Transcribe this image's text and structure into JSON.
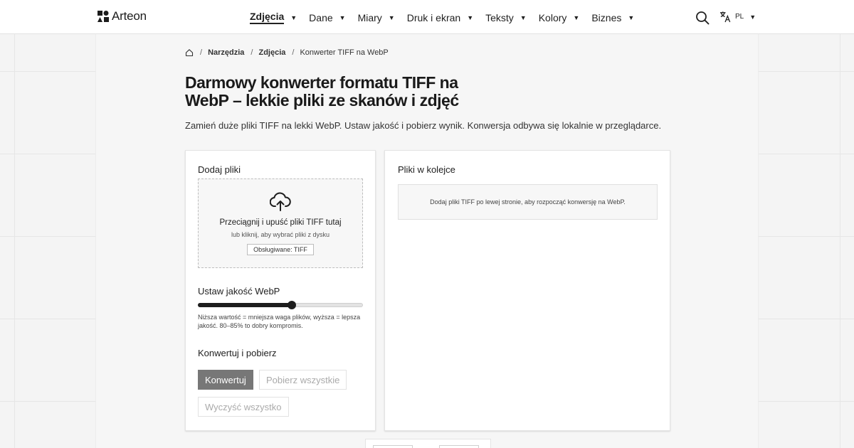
{
  "brand": {
    "name": "Arteon"
  },
  "nav": {
    "items": [
      {
        "label": "Zdjęcia",
        "active": true
      },
      {
        "label": "Dane",
        "active": false
      },
      {
        "label": "Miary",
        "active": false
      },
      {
        "label": "Druk i ekran",
        "active": false
      },
      {
        "label": "Teksty",
        "active": false
      },
      {
        "label": "Kolory",
        "active": false
      },
      {
        "label": "Biznes",
        "active": false
      }
    ],
    "language": "PL",
    "search_icon": "search-icon",
    "language_icon": "translate-icon"
  },
  "breadcrumb": {
    "home_icon": "home-icon",
    "items": [
      "Narzędzia",
      "Zdjęcia"
    ],
    "current": "Konwerter TIFF na WebP"
  },
  "page": {
    "title": "Darmowy konwerter formatu TIFF na WebP – lekkie pliki ze skanów i zdjęć",
    "intro": "Zamień duże pliki TIFF na lekki WebP. Ustaw jakość i pobierz wynik. Konwersja odbywa się lokalnie w przeglądarce."
  },
  "upload": {
    "heading": "Dodaj pliki",
    "icon": "cloud-upload-icon",
    "drop_text": "Przeciągnij i upuść pliki TIFF tutaj",
    "click_text": "lub kliknij, aby wybrać pliki z dysku",
    "supported": "Obsługiwane: TIFF"
  },
  "quality": {
    "heading": "Ustaw jakość WebP",
    "level": 0.57,
    "hint": "Niższa wartość = mniejsza waga plików, wyższa = lepsza jakość. 80–85% to dobry kompromis."
  },
  "actions": {
    "heading": "Konwertuj i pobierz",
    "convert": "Konwertuj",
    "download_all": "Pobierz wszystkie",
    "clear_all": "Wyczyść wszystko"
  },
  "queue": {
    "heading": "Pliki w kolejce",
    "empty": "Dodaj pliki TIFF po lewej stronie, aby rozpocząć konwersję na WebP."
  },
  "colors": {
    "accent": "#1d1d1d",
    "primary_button": "#777777",
    "background": "#f4f4f4"
  }
}
